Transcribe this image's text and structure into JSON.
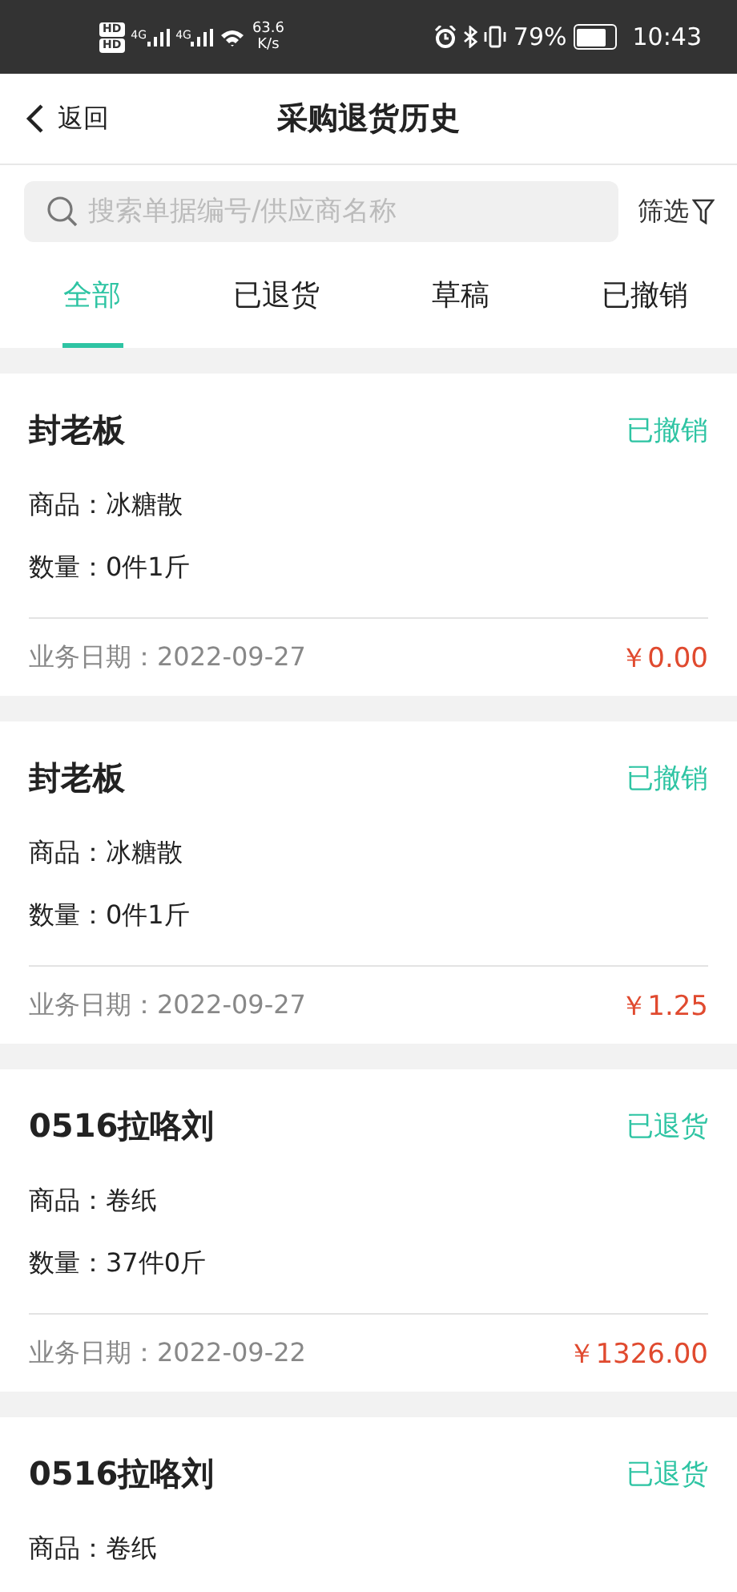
{
  "status_bar": {
    "sim_labels": [
      "HD",
      "HD"
    ],
    "network_labels": [
      "4G",
      "4G"
    ],
    "speed": "63.6",
    "speed_unit": "K/s",
    "battery": "79%",
    "time": "10:43"
  },
  "header": {
    "back": "返回",
    "title": "采购退货历史"
  },
  "search": {
    "placeholder": "搜索单据编号/供应商名称",
    "filter": "筛选"
  },
  "tabs": [
    {
      "label": "全部",
      "selected": true
    },
    {
      "label": "已退货",
      "selected": false
    },
    {
      "label": "草稿",
      "selected": false
    },
    {
      "label": "已撤销",
      "selected": false
    }
  ],
  "orders": [
    {
      "supplier": "封老板",
      "status": "已撤销",
      "goods": "商品：冰糖散",
      "quantity": "数量：0件1斤",
      "date": "业务日期：2022-09-27",
      "amount": "￥0.00"
    },
    {
      "supplier": "封老板",
      "status": "已撤销",
      "goods": "商品：冰糖散",
      "quantity": "数量：0件1斤",
      "date": "业务日期：2022-09-27",
      "amount": "￥1.25"
    },
    {
      "supplier": "0516拉咯刘",
      "status": "已退货",
      "goods": "商品：卷纸",
      "quantity": "数量：37件0斤",
      "date": "业务日期：2022-09-22",
      "amount": "￥1326.00"
    },
    {
      "supplier": "0516拉咯刘",
      "status": "已退货",
      "goods": "商品：卷纸"
    }
  ]
}
